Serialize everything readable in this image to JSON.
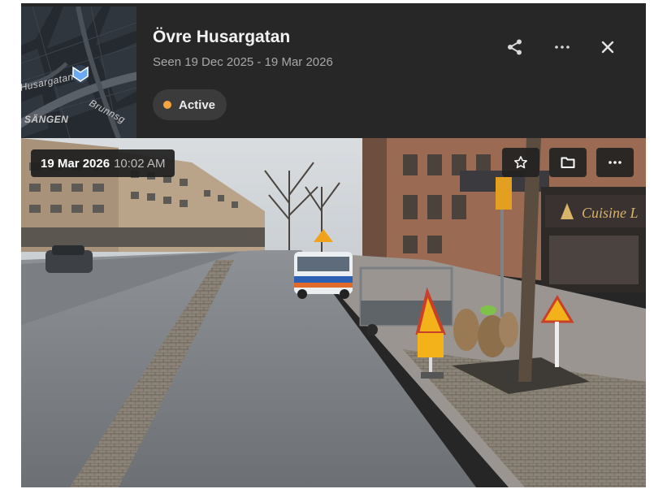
{
  "header": {
    "title": "Övre Husargatan",
    "seen_range": "Seen 19 Dec 2025 - 19 Mar 2026",
    "status": {
      "label": "Active",
      "dot_color": "#f4a53c"
    },
    "actions": {
      "share_icon": "share-icon",
      "more_icon": "more-horizontal-icon",
      "close_icon": "close-icon"
    }
  },
  "map_thumbnail": {
    "labels": [
      "Husargatan",
      "Brunnsg",
      "SÄNGEN"
    ],
    "marker_icon": "location-heading-icon",
    "marker_color": "#6aa9f5"
  },
  "photo": {
    "date": "19 Mar 2026",
    "time": "10:02 AM",
    "actions": {
      "favorite_icon": "star-icon",
      "folder_icon": "folder-icon",
      "more_icon": "more-horizontal-icon"
    }
  },
  "colors": {
    "panel": "#262626",
    "accent": "#f4a53c"
  }
}
